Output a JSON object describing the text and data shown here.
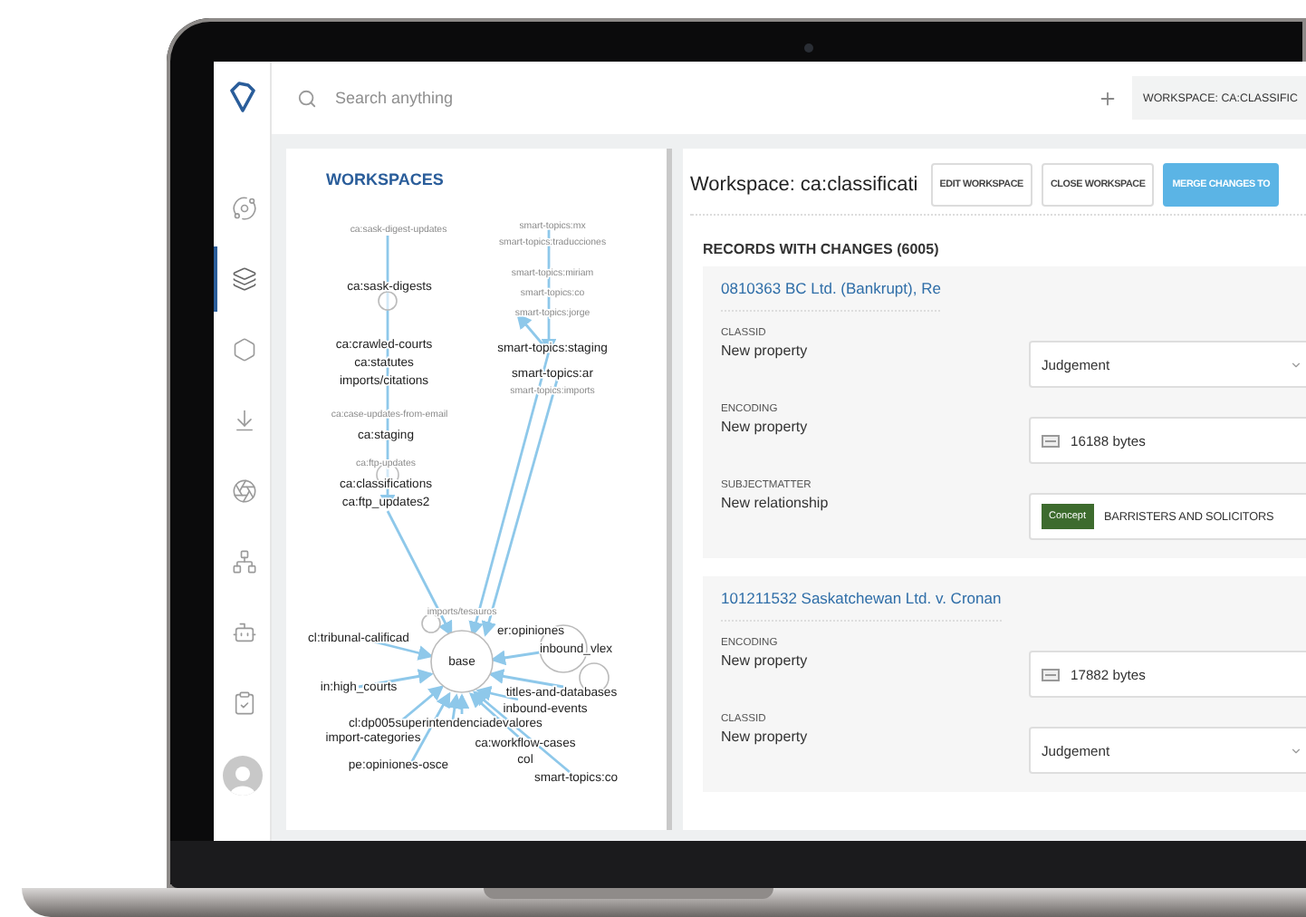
{
  "sidebar": {
    "items": [
      {
        "selected": false
      },
      {
        "selected": true
      },
      {
        "selected": false
      },
      {
        "selected": false
      },
      {
        "selected": false
      },
      {
        "selected": false
      },
      {
        "selected": false
      },
      {
        "selected": false
      }
    ]
  },
  "topbar": {
    "search": {
      "placeholder": "Search anything"
    },
    "workspace_chip": "WORKSPACE: CA:CLASSIFIC"
  },
  "graph": {
    "title": "WORKSPACES",
    "nodes": [
      {
        "label": "ca:sask-digest-updates",
        "kind": "secondary"
      },
      {
        "label": "smart-topics:mx",
        "kind": "secondary"
      },
      {
        "label": "smart-topics:traducciones",
        "kind": "secondary"
      },
      {
        "label": "ca:sask-digests",
        "kind": "primary"
      },
      {
        "label": "smart-topics:miriam",
        "kind": "secondary"
      },
      {
        "label": "smart-topics:co",
        "kind": "secondary"
      },
      {
        "label": "smart-topics:jorge",
        "kind": "secondary"
      },
      {
        "label": "ca:crawled-courts",
        "kind": "primary"
      },
      {
        "label": "smart-topics:staging",
        "kind": "primary"
      },
      {
        "label": "ca:statutes",
        "kind": "primary"
      },
      {
        "label": "imports/citations",
        "kind": "primary"
      },
      {
        "label": "smart-topics:ar",
        "kind": "primary"
      },
      {
        "label": "smart-topics:imports",
        "kind": "secondary"
      },
      {
        "label": "ca:case-updates-from-email",
        "kind": "secondary"
      },
      {
        "label": "ca:staging",
        "kind": "primary"
      },
      {
        "label": "ca:ftp-updates",
        "kind": "secondary"
      },
      {
        "label": "ca:classifications",
        "kind": "primary"
      },
      {
        "label": "ca:ftp_updates2",
        "kind": "primary"
      },
      {
        "label": "imports/tesauros",
        "kind": "secondary"
      },
      {
        "label": "cl:tribunal-calificad",
        "kind": "primary"
      },
      {
        "label": "er:opiniones",
        "kind": "primary"
      },
      {
        "label": "base",
        "kind": "primary"
      },
      {
        "label": "inbound_vlex",
        "kind": "primary"
      },
      {
        "label": "in:high_courts",
        "kind": "primary"
      },
      {
        "label": "titles-and-databases",
        "kind": "primary"
      },
      {
        "label": "inbound-events",
        "kind": "primary"
      },
      {
        "label": "cl:dp005superintendenciadevalores",
        "kind": "primary"
      },
      {
        "label": "import-categories",
        "kind": "primary"
      },
      {
        "label": "ca:workflow-cases",
        "kind": "primary"
      },
      {
        "label": "pe:opiniones-osce",
        "kind": "primary"
      },
      {
        "label": "col",
        "kind": "primary"
      },
      {
        "label": "smart-topics:co",
        "kind": "primary"
      }
    ]
  },
  "workspace": {
    "title": "Workspace: ca:classificati",
    "buttons": [
      {
        "label": "EDIT WORKSPACE",
        "kind": "outline"
      },
      {
        "label": "CLOSE WORKSPACE",
        "kind": "outline"
      },
      {
        "label": "MERGE CHANGES TO",
        "kind": "primary"
      }
    ],
    "records_heading": "RECORDS WITH CHANGES (6005)",
    "records": [
      {
        "title": "0810363 BC Ltd. (Bankrupt), Re",
        "fields": [
          {
            "label": "CLASSID",
            "change": "New property",
            "kind": "select",
            "value": "Judgement"
          },
          {
            "label": "ENCODING",
            "change": "New property",
            "kind": "file",
            "value": "16188 bytes"
          },
          {
            "label": "SUBJECTMATTER",
            "change": "New relationship",
            "kind": "concept",
            "tag": "Concept",
            "value": "BARRISTERS AND SOLICITORS"
          }
        ]
      },
      {
        "title": "101211532 Saskatchewan Ltd. v. Cronan",
        "fields": [
          {
            "label": "ENCODING",
            "change": "New property",
            "kind": "file",
            "value": "17882 bytes"
          },
          {
            "label": "CLASSID",
            "change": "New property",
            "kind": "select",
            "value": "Judgement"
          }
        ]
      }
    ]
  }
}
